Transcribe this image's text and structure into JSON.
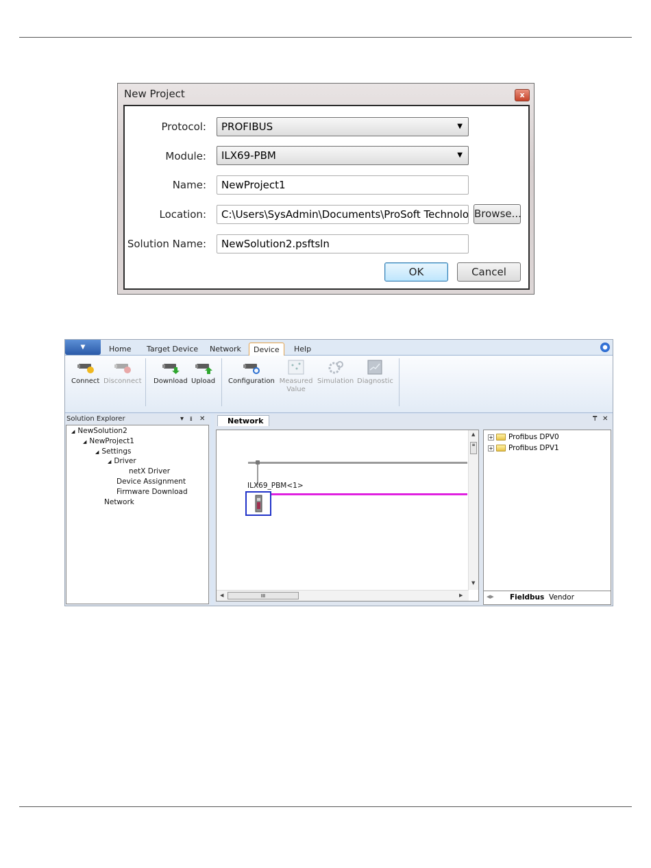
{
  "dialog": {
    "title": "New Project",
    "fields": {
      "protocol": {
        "label": "Protocol:",
        "value": "PROFIBUS"
      },
      "module": {
        "label": "Module:",
        "value": "ILX69-PBM"
      },
      "name": {
        "label": "Name:",
        "value": "NewProject1"
      },
      "location": {
        "label": "Location:",
        "value": "C:\\Users\\SysAdmin\\Documents\\ProSoft Technology"
      },
      "solution": {
        "label": "Solution Name:",
        "value": "NewSolution2.psftsln"
      }
    },
    "browse_label": "Browse...",
    "ok_label": "OK",
    "cancel_label": "Cancel"
  },
  "app": {
    "tabs": [
      "Home",
      "Target Device",
      "Network",
      "Device",
      "Help"
    ],
    "active_tab": "Device",
    "ribbon": [
      {
        "label": "Connect",
        "icon": "connect-icon",
        "enabled": true
      },
      {
        "label": "Disconnect",
        "icon": "disconnect-icon",
        "enabled": false
      },
      {
        "label": "Download",
        "icon": "download-icon",
        "enabled": true
      },
      {
        "label": "Upload",
        "icon": "upload-icon",
        "enabled": true
      },
      {
        "label": "Configuration",
        "icon": "configuration-icon",
        "enabled": true
      },
      {
        "label": "Measured Value",
        "icon": "measured-value-icon",
        "enabled": false
      },
      {
        "label": "Simulation",
        "icon": "simulation-icon",
        "enabled": false
      },
      {
        "label": "Diagnostic",
        "icon": "diagnostic-icon",
        "enabled": false
      }
    ],
    "explorer": {
      "title": "Solution Explorer",
      "tree": [
        {
          "label": "NewSolution2",
          "expanded": true
        },
        {
          "label": "NewProject1",
          "expanded": true
        },
        {
          "label": "Settings",
          "expanded": true
        },
        {
          "label": "Driver",
          "expanded": true
        },
        {
          "label": "netX Driver"
        },
        {
          "label": "Device Assignment"
        },
        {
          "label": "Firmware Download"
        },
        {
          "label": "Network"
        }
      ]
    },
    "document": {
      "tab_label": "Network",
      "device_label": "ILX69_PBM<1>",
      "scroll_thumb_glyph": "III"
    },
    "catalog": {
      "items": [
        "Profibus DPV0",
        "Profibus DPV1"
      ],
      "tabs": [
        "Fieldbus",
        "Vendor"
      ],
      "active_tab": "Fieldbus"
    },
    "colors": {
      "bus_line": "#e020e0",
      "accent_tab_border": "#e3a14a",
      "device_selection": "#2032c8"
    }
  }
}
